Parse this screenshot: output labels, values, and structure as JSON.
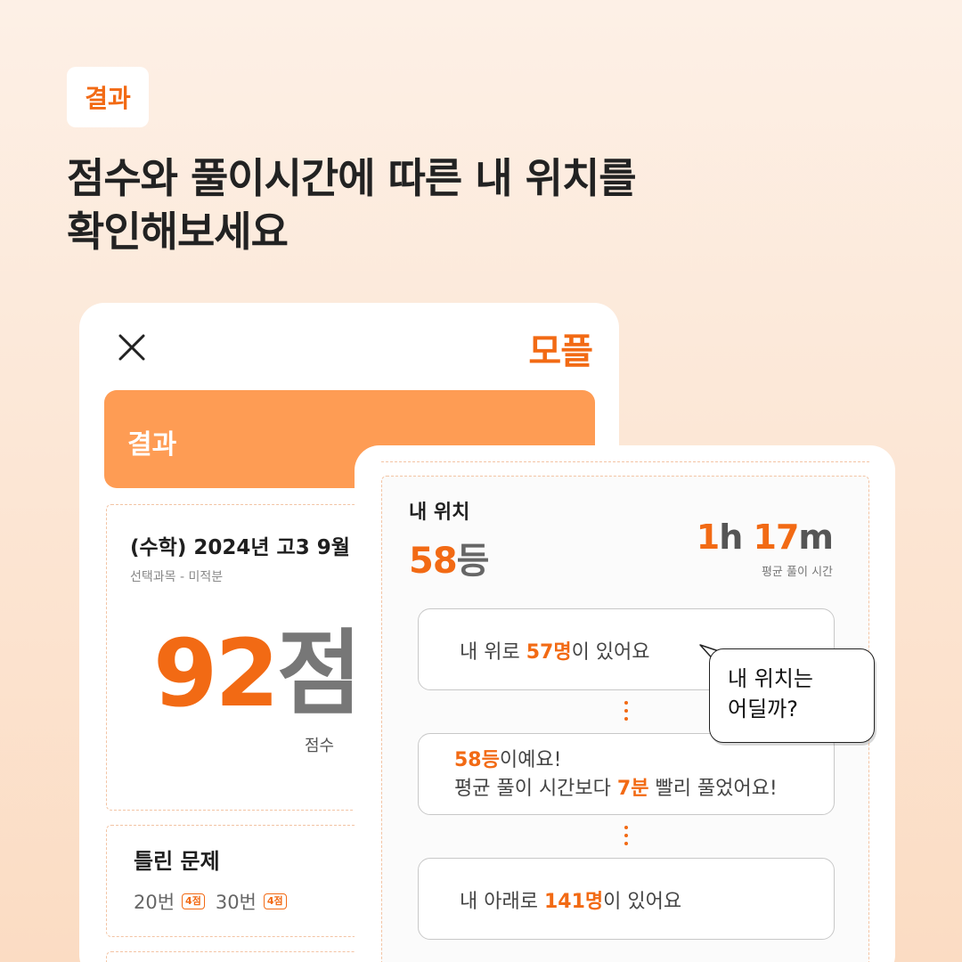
{
  "badge": "결과",
  "headline": {
    "line1": "점수와 풀이시간에 따른 내 위치를",
    "line2": "확인해보세요"
  },
  "back_card": {
    "brand": "모플",
    "result_label": "결과",
    "exam_title": "(수학) 2024년 고3 9월",
    "exam_sub": "선택과목 - 미적분",
    "score_value": "92",
    "score_unit": "점",
    "score_label": "점수",
    "wrong_title": "틀린 문제",
    "wrong_items": [
      {
        "label": "20번",
        "points": "4점"
      },
      {
        "label": "30번",
        "points": "4점"
      }
    ]
  },
  "front_card": {
    "section_label": "내 위치",
    "rank_value": "58",
    "rank_unit": "등",
    "time": {
      "h_value": "1",
      "h_unit": "h",
      "m_value": "17",
      "m_unit": "m"
    },
    "time_label": "평균 풀이 시간",
    "above": {
      "pre": "내 위로 ",
      "count": "57명",
      "post": "이 있어요"
    },
    "middle": {
      "rank": "58등",
      "line1_post": "이예요!",
      "line2_pre": "평균 풀이 시간보다 ",
      "line2_value": "7분",
      "line2_post": " 빨리 풀었어요!"
    },
    "below": {
      "pre": "내 아래로 ",
      "count": "141명",
      "post": "이 있어요"
    }
  },
  "bubble": {
    "line1": "내 위치는",
    "line2": "어딜까?"
  },
  "colors": {
    "accent": "#f26a14",
    "bar": "#fe9c54",
    "background": "#fbdcc3"
  }
}
